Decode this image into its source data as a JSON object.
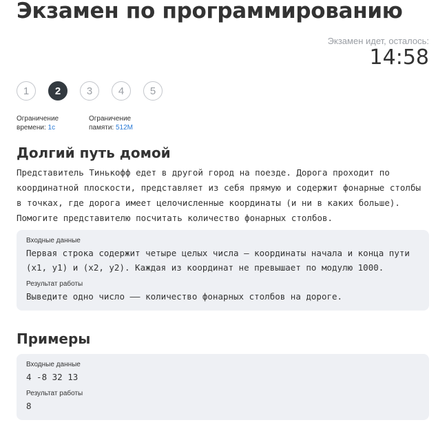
{
  "page": {
    "title": "Экзамен по программированию"
  },
  "timer": {
    "label": "Экзамен идет, осталось:",
    "value": "14:58"
  },
  "steps": [
    {
      "label": "1",
      "active": false
    },
    {
      "label": "2",
      "active": true
    },
    {
      "label": "3",
      "active": false
    },
    {
      "label": "4",
      "active": false
    },
    {
      "label": "5",
      "active": false
    }
  ],
  "limits": {
    "time": {
      "line1": "Ограничение",
      "line2": "времени:",
      "value": "1с"
    },
    "memory": {
      "line1": "Ограничение",
      "line2": "памяти:",
      "value": "512М"
    }
  },
  "task": {
    "title": "Долгий путь домой",
    "statement": "Представитель Тинькофф едет в другой город на поезде. Дорога проходит по координатной плоскости, представляет из себя прямую и содержит фонарные столбы в точках, где дорога имеет целочисленные координаты (и ни в каких больше). Помогите представителю посчитать количество фонарных столбов.",
    "io": {
      "input_label": "Входные данные",
      "input_text": "Первая строка содержит четыре целых числа — координаты начала и конца пути (x1, y1) и (x2, y2). Каждая из координат не превышает по модулю 1000.",
      "output_label": "Результат работы",
      "output_text": "Выведите одно число –– количество фонарных столбов на дороге."
    }
  },
  "examples": {
    "title": "Примеры",
    "input_label": "Входные данные",
    "input_value": "4 -8 32 13",
    "output_label": "Результат работы",
    "output_value": "8"
  },
  "colors": {
    "accent": "#2b7bd6",
    "active_step": "#333a40",
    "box_bg": "#eef0f4"
  }
}
